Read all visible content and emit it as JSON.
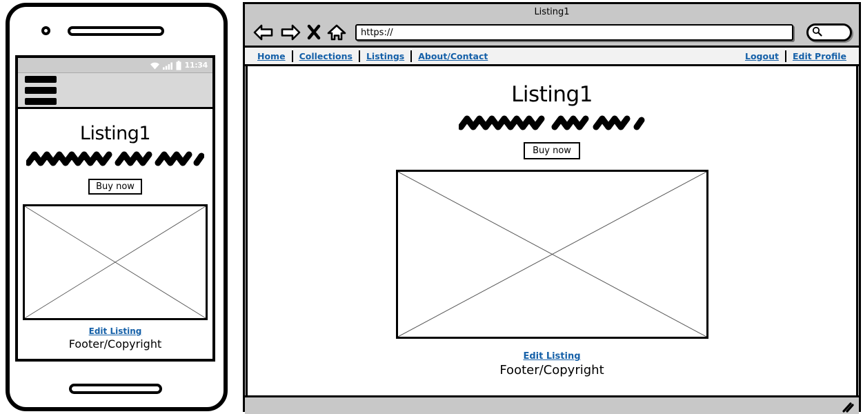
{
  "mobile": {
    "status_bar": {
      "wifi_icon": "wifi-icon",
      "signal_icon": "signal-bars-icon",
      "battery_icon": "battery-icon",
      "time": "11:34"
    },
    "app_bar": {
      "menu_icon": "hamburger-menu-icon"
    },
    "title": "Listing1",
    "description_placeholder": "scribble-text-placeholder",
    "buy_button": "Buy now",
    "image_placeholder": "image-placeholder-x",
    "edit_link": "Edit Listing",
    "footer": "Footer/Copyright"
  },
  "browser": {
    "window_title": "Listing1",
    "toolbar": {
      "back_icon": "back-arrow-icon",
      "forward_icon": "forward-arrow-icon",
      "stop_icon": "stop-x-icon",
      "home_icon": "home-icon",
      "url_value": "https://",
      "url_placeholder": "https://",
      "search_icon": "search-icon",
      "search_value": "",
      "search_placeholder": ""
    },
    "nav_left": [
      {
        "label": "Home",
        "name": "nav-link-home"
      },
      {
        "label": "Collections",
        "name": "nav-link-collections"
      },
      {
        "label": "Listings",
        "name": "nav-link-listings"
      },
      {
        "label": "About/Contact",
        "name": "nav-link-about-contact"
      }
    ],
    "nav_right": [
      {
        "label": "Logout",
        "name": "nav-link-logout"
      },
      {
        "label": "Edit Profile",
        "name": "nav-link-edit-profile"
      }
    ],
    "page": {
      "title": "Listing1",
      "description_placeholder": "scribble-text-placeholder",
      "buy_button": "Buy now",
      "image_placeholder": "image-placeholder-x",
      "edit_link": "Edit Listing",
      "footer": "Footer/Copyright"
    },
    "status_bar": {
      "resize_icon": "resize-grip-icon"
    }
  },
  "colors": {
    "link": "#1560a8",
    "chrome_gray": "#c8c8c8",
    "appbar_gray": "#d8d8d8",
    "statusbar_gray": "#cccccc",
    "outline": "#000000",
    "placeholder_x": "#555555"
  }
}
